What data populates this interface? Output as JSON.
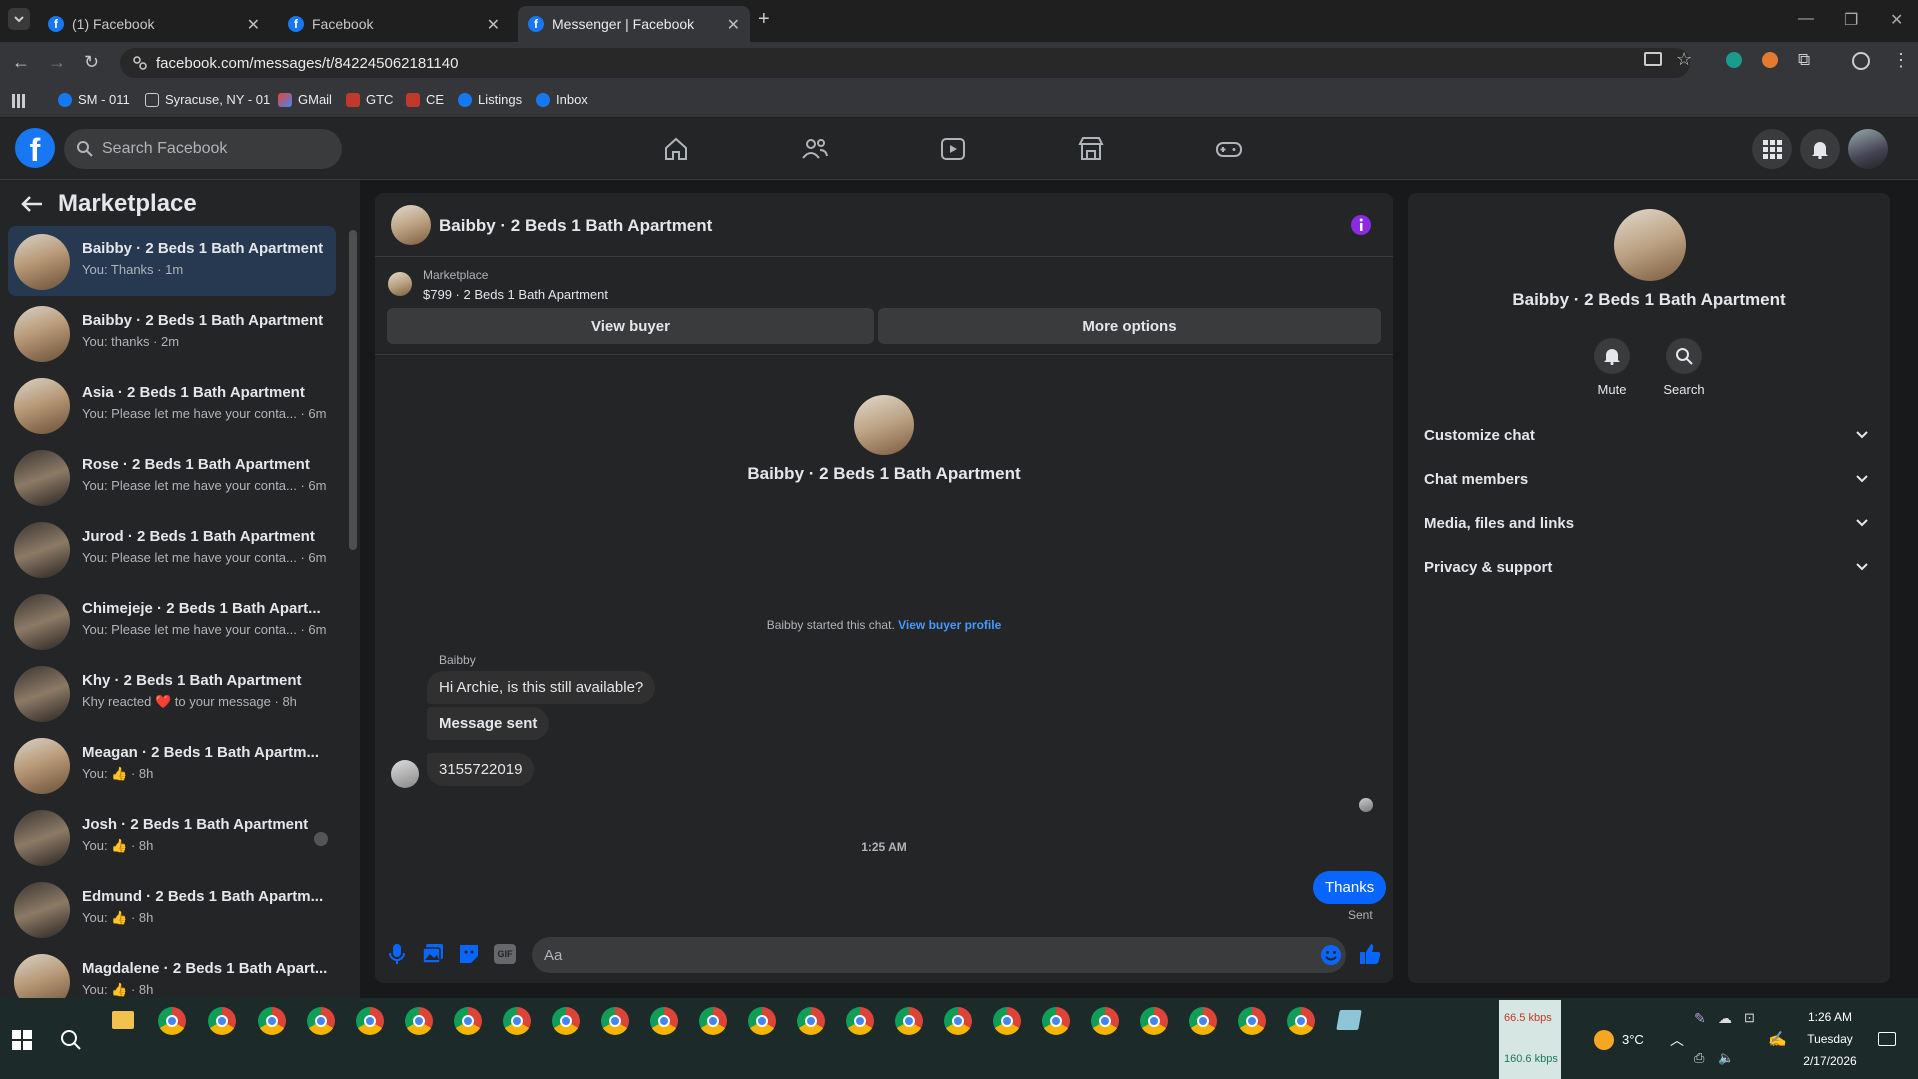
{
  "browser": {
    "tabs": [
      {
        "label": "(1) Facebook"
      },
      {
        "label": "Facebook"
      },
      {
        "label": "Messenger | Facebook"
      }
    ],
    "url": "facebook.com/messages/t/842245062181140",
    "bookmarks": [
      {
        "label": "SM - 011",
        "icon": "facebook-icon"
      },
      {
        "label": "Syracuse, NY - 01",
        "icon": "folder-icon"
      },
      {
        "label": "GMail",
        "icon": "gmail-icon"
      },
      {
        "label": "GTC",
        "icon": "bookmark-icon"
      },
      {
        "label": "CE",
        "icon": "bookmark-icon"
      },
      {
        "label": "Listings",
        "icon": "facebook-icon"
      },
      {
        "label": "Inbox",
        "icon": "facebook-icon"
      }
    ]
  },
  "header": {
    "logo": "f",
    "search_placeholder": "Search Facebook"
  },
  "sidebar": {
    "title": "Marketplace",
    "conversations": [
      {
        "title": "Baibby · 2 Beds 1 Bath Apartment",
        "snippet": "You: Thanks · 1m",
        "active": true
      },
      {
        "title": "Baibby · 2 Beds 1 Bath Apartment",
        "snippet": "You: thanks · 2m"
      },
      {
        "title": "Asia · 2 Beds 1 Bath Apartment",
        "snippet": "You: Please let me have your conta... · 6m"
      },
      {
        "title": "Rose · 2 Beds 1 Bath Apartment",
        "snippet": "You: Please let me have your conta... · 6m"
      },
      {
        "title": "Jurod · 2 Beds 1 Bath Apartment",
        "snippet": "You: Please let me have your conta... · 6m"
      },
      {
        "title": "Chimejeje · 2 Beds 1 Bath Apart...",
        "snippet": "You: Please let me have your conta... · 6m"
      },
      {
        "title": "Khy · 2 Beds 1 Bath Apartment",
        "snippet": "Khy reacted ❤️ to your message · 8h"
      },
      {
        "title": "Meagan · 2 Beds 1 Bath Apartm...",
        "snippet": "You: 👍 · 8h"
      },
      {
        "title": "Josh · 2 Beds 1 Bath Apartment",
        "snippet": "You: 👍 · 8h"
      },
      {
        "title": "Edmund · 2 Beds 1 Bath Apartm...",
        "snippet": "You: 👍 · 8h"
      },
      {
        "title": "Magdalene · 2 Beds 1 Bath Apart...",
        "snippet": "You: 👍 · 8h"
      }
    ]
  },
  "chat": {
    "title": "Baibby · 2 Beds 1 Bath Apartment",
    "listing_source": "Marketplace",
    "listing": "$799 · 2 Beds 1 Bath Apartment",
    "view_buyer": "View buyer",
    "more_options": "More options",
    "intro_name": "Baibby · 2 Beds 1 Bath Apartment",
    "started": "Baibby started this chat.",
    "view_buyer_profile": "View buyer profile",
    "sender_name": "Baibby",
    "messages": [
      {
        "text": "Hi Archie, is this still available?"
      },
      {
        "text": "Message sent",
        "bold": true
      },
      {
        "text": "3155722019"
      }
    ],
    "time_divider": "1:25 AM",
    "my_message": "Thanks",
    "status": "Sent",
    "composer_placeholder": "Aa"
  },
  "details": {
    "name": "Baibby · 2 Beds 1 Bath Apartment",
    "mute": "Mute",
    "search": "Search",
    "sections": [
      "Customize chat",
      "Chat members",
      "Media, files and links",
      "Privacy & support"
    ]
  },
  "taskbar": {
    "net_down": "66.5 kbps",
    "net_up": "160.6 kbps",
    "weather": "3°C",
    "time": "1:26 AM",
    "day": "Tuesday",
    "date": "2/17/2026"
  },
  "colors": {
    "accent": "#0866ff",
    "fb_blue": "#1877f2",
    "panel": "#242526",
    "background": "#18191a"
  }
}
